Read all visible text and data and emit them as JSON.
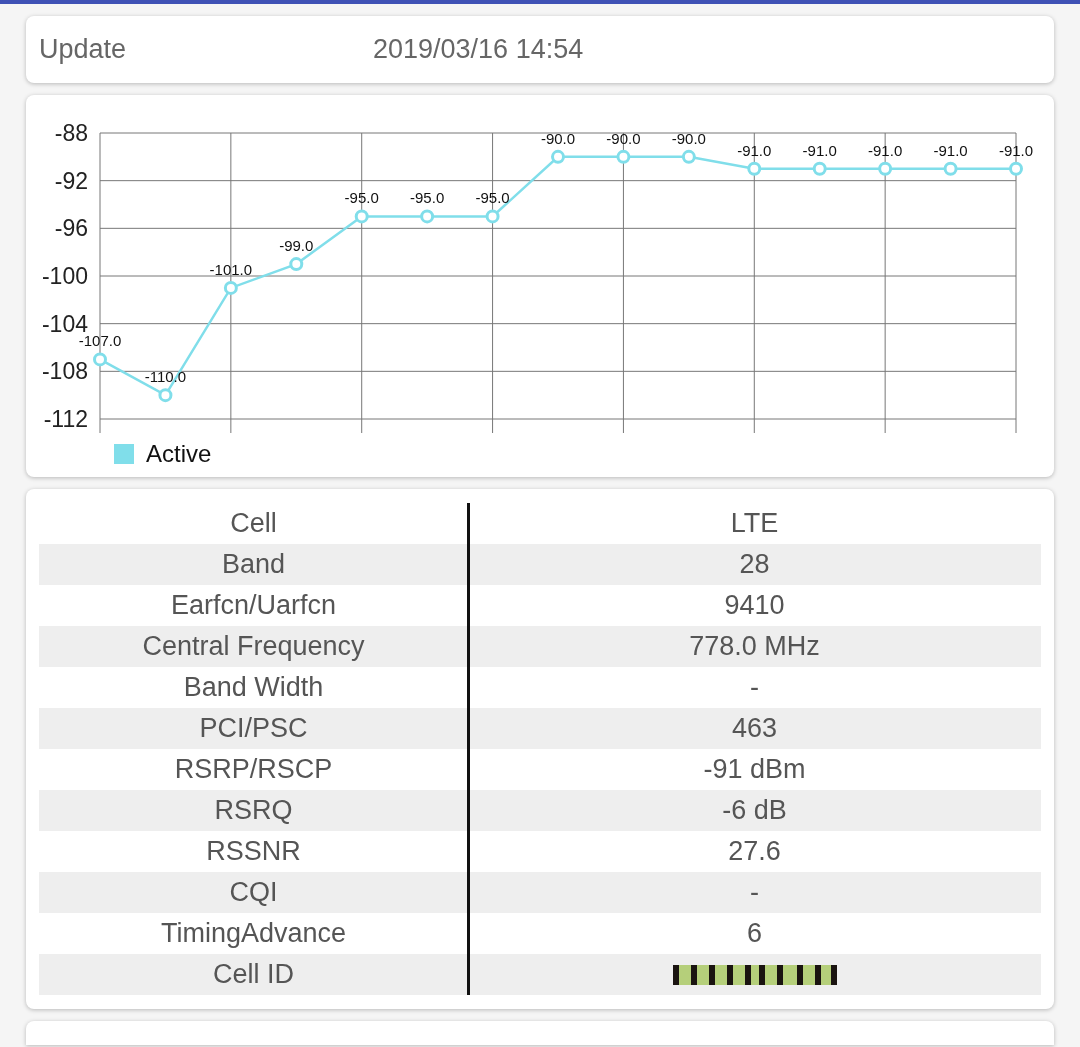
{
  "update": {
    "label": "Update",
    "time": "2019/03/16 14:54"
  },
  "signal_chart": {
    "chart_data": {
      "type": "line",
      "grid": true,
      "series": [
        {
          "name": "Active",
          "color": "#80deea",
          "marker": "circle",
          "values": [
            -107,
            -110,
            -101,
            -99,
            -95,
            -95,
            -95,
            -90,
            -90,
            -90,
            -91,
            -91,
            -91,
            -91,
            -91
          ]
        }
      ],
      "ylim": [
        -112,
        -88
      ],
      "yticks": [
        -88,
        -92,
        -96,
        -100,
        -104,
        -108,
        -112
      ],
      "value_labels": [
        "-107.0",
        "-110.0",
        "-101.0",
        "-99.0",
        "-95.0",
        "-95.0",
        "-95.0",
        "-90.0",
        "-90.0",
        "-90.0",
        "-91.0",
        "-91.0",
        "-91.0",
        "-91.0",
        "-91.0"
      ]
    }
  },
  "cell_info": {
    "rows": [
      {
        "kind": "text",
        "label": "Cell",
        "value": "LTE"
      },
      {
        "kind": "text",
        "label": "Band",
        "value": "28"
      },
      {
        "kind": "text",
        "label": "Earfcn/Uarfcn",
        "value": "9410"
      },
      {
        "kind": "text",
        "label": "Central Frequency",
        "value": "778.0 MHz"
      },
      {
        "kind": "text",
        "label": "Band Width",
        "value": "-"
      },
      {
        "kind": "text",
        "label": "PCI/PSC",
        "value": "463"
      },
      {
        "kind": "text",
        "label": "RSRP/RSCP",
        "value": "-91 dBm"
      },
      {
        "kind": "text",
        "label": "RSRQ",
        "value": "-6 dB"
      },
      {
        "kind": "text",
        "label": "RSSNR",
        "value": "27.6"
      },
      {
        "kind": "text",
        "label": "CQI",
        "value": "-"
      },
      {
        "kind": "text",
        "label": "TimingAdvance",
        "value": "6"
      },
      {
        "kind": "redacted",
        "label": "Cell ID"
      }
    ]
  }
}
